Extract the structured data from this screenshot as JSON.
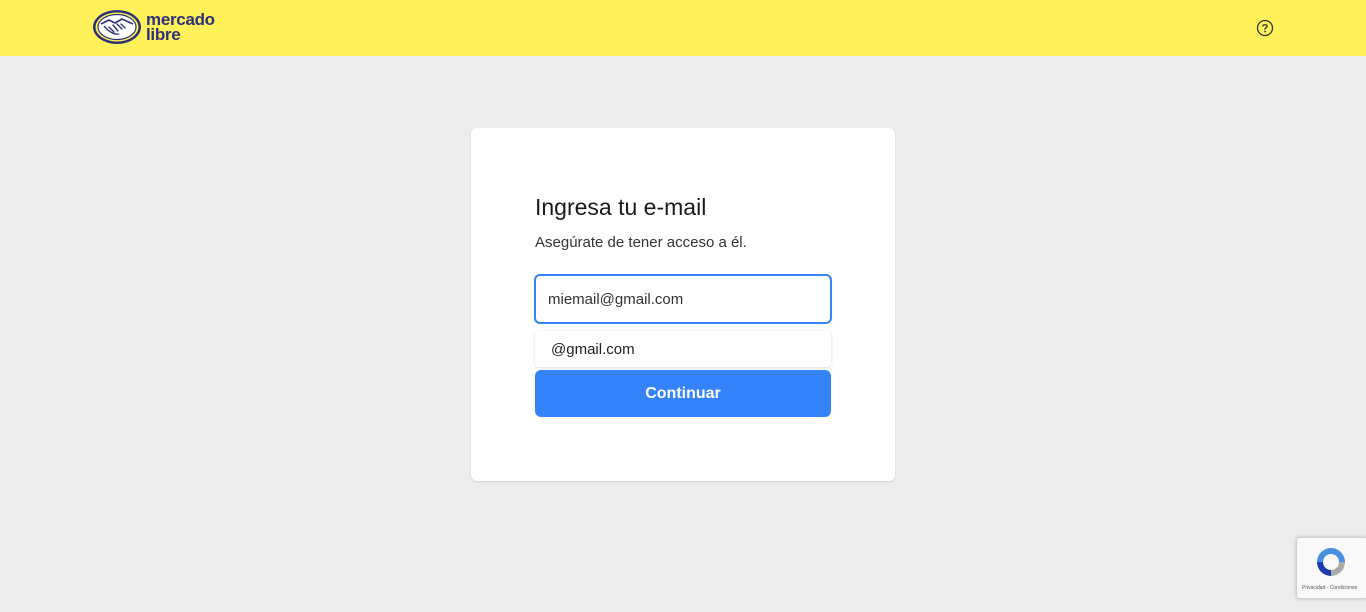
{
  "header": {
    "logo_line1": "mercado",
    "logo_line2": "libre",
    "help_icon": "question-circle-icon",
    "background_color": "#fff159",
    "brand_text_color": "#2d3277"
  },
  "login": {
    "title": "Ingresa tu e-mail",
    "subtitle": "Asegúrate de tener acceso a él.",
    "email_value": "miemail@gmail.com",
    "suggestion": "@gmail.com",
    "continue_label": "Continuar",
    "accent_color": "#3483fa"
  },
  "recaptcha": {
    "icon": "recaptcha-icon",
    "footer_text": "Privacidad - Condiciones"
  }
}
